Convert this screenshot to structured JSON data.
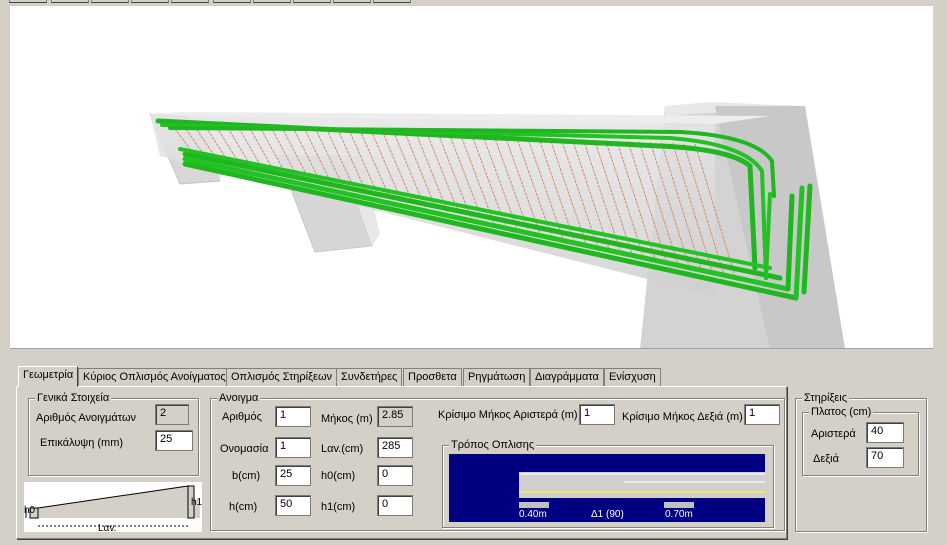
{
  "tabs": [
    {
      "label": "Γεωμετρία"
    },
    {
      "label": "Κύριος Οπλισμός Ανοίγματος"
    },
    {
      "label": "Οπλισμός Στηρίξεων"
    },
    {
      "label": "Συνδετήρες"
    },
    {
      "label": "Προσθετα"
    },
    {
      "label": "Ρηγμάτωση"
    },
    {
      "label": "Διαγράμματα"
    },
    {
      "label": "Ενίσχυση"
    }
  ],
  "general": {
    "title": "Γενικά Στοιχεία",
    "spans_label": "Αριθμός Ανοιγμάτων",
    "spans_value": "2",
    "cover_label": "Επικάλυψη (mm)",
    "cover_value": "25"
  },
  "span": {
    "title": "Ανοιγμα",
    "number_label": "Αριθμός",
    "number_value": "1",
    "length_label": "Μήκος (m)",
    "length_value": "2.85",
    "name_label": "Ονομασία",
    "name_value": "1",
    "lav_label": "Lαv.(cm)",
    "lav_value": "285",
    "b_label": "b(cm)",
    "b_value": "25",
    "h0_label": "h0(cm)",
    "h0_value": "0",
    "h_label": "h(cm)",
    "h_value": "50",
    "h1_label": "h1(cm)",
    "h1_value": "0",
    "crit_left_label": "Κρίσιμο Μήκος Αριστερά (m)",
    "crit_left_value": "1",
    "crit_right_label": "Κρίσιμο Μήκος Δεξιά (m)",
    "crit_right_value": "1",
    "mode_title": "Τρόπος Οπλισης",
    "mode_left": "0.40m",
    "mode_mid": "Δ1 (90)",
    "mode_right": "0.70m"
  },
  "supports": {
    "title": "Στηρίξεις",
    "width_title": "Πλατος (cm)",
    "left_label": "Αριστερά",
    "left_value": "40",
    "right_label": "Δεξιά",
    "right_value": "70"
  },
  "diagram": {
    "h0": "h0",
    "h1": "h1",
    "lav": "Lαv."
  },
  "colors": {
    "rebar": "#1fb61f",
    "stirrup": "#d98a6a",
    "mode_bg": "#000080"
  }
}
